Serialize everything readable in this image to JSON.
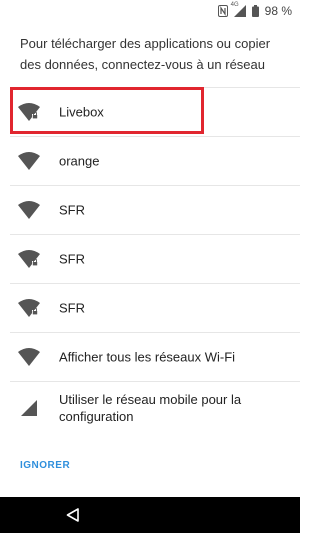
{
  "status_bar": {
    "icons": [
      "nfc-icon",
      "signal-4g-icon",
      "battery-icon"
    ],
    "battery_text": "98 %",
    "network_type": "4G"
  },
  "intro_text": "Pour télécharger des applications ou copier des données, connectez-vous à un réseau",
  "networks": [
    {
      "label": "Livebox",
      "icon": "wifi-lock-icon",
      "highlighted": true
    },
    {
      "label": "orange",
      "icon": "wifi-icon"
    },
    {
      "label": "SFR",
      "icon": "wifi-icon"
    },
    {
      "label": "SFR",
      "icon": "wifi-lock-icon"
    },
    {
      "label": "SFR",
      "icon": "wifi-lock-icon"
    },
    {
      "label": "Afficher tous les réseaux Wi-Fi",
      "icon": "wifi-icon"
    },
    {
      "label": "Utiliser le réseau mobile pour la configuration",
      "icon": "mobile-signal-icon"
    }
  ],
  "skip_label": "IGNORER",
  "colors": {
    "highlight": "#e1262f",
    "accent": "#2f8fdc"
  }
}
